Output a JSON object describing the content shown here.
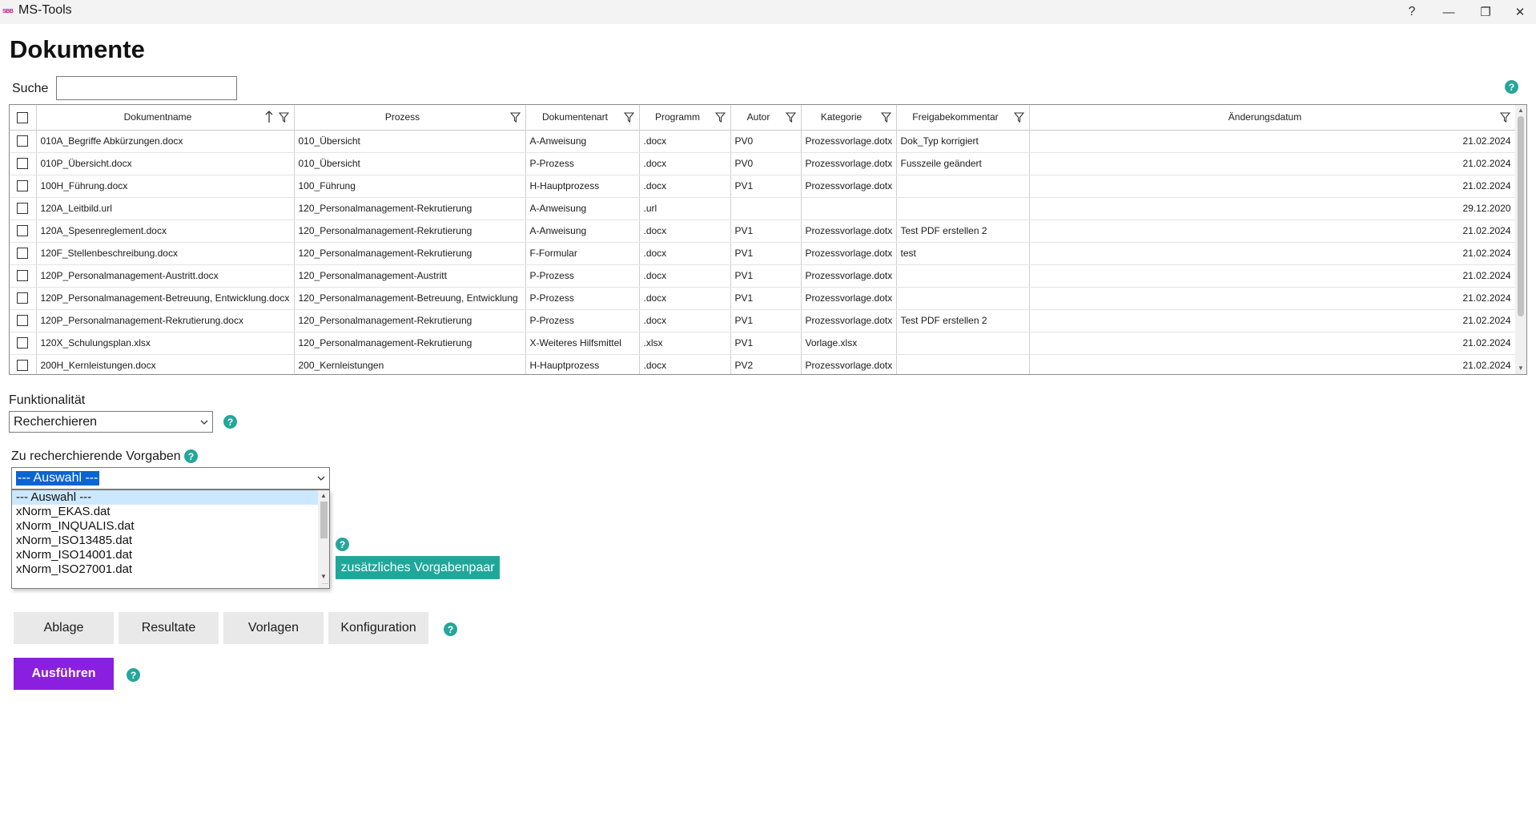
{
  "window": {
    "title": "MS-Tools",
    "logo_text": "SBB",
    "help_glyph": "?",
    "minimize_glyph": "—",
    "maximize_glyph": "❐",
    "close_glyph": "✕"
  },
  "page": {
    "title": "Dokumente"
  },
  "search": {
    "label": "Suche",
    "value": ""
  },
  "help_glyph": "?",
  "table": {
    "columns": [
      "Dokumentname",
      "Prozess",
      "Dokumentenart",
      "Programm",
      "Autor",
      "Kategorie",
      "Freigabekommentar",
      "Änderungsdatum"
    ],
    "sorted_column": "Dokumentname",
    "rows": [
      [
        "010A_Begriffe Abkürzungen.docx",
        "010_Übersicht",
        "A-Anweisung",
        ".docx",
        "PV0",
        "Prozessvorlage.dotx",
        "Dok_Typ korrigiert",
        "21.02.2024"
      ],
      [
        "010P_Übersicht.docx",
        "010_Übersicht",
        "P-Prozess",
        ".docx",
        "PV0",
        "Prozessvorlage.dotx",
        "Fusszeile geändert",
        "21.02.2024"
      ],
      [
        "100H_Führung.docx",
        "100_Führung",
        "H-Hauptprozess",
        ".docx",
        "PV1",
        "Prozessvorlage.dotx",
        "",
        "21.02.2024"
      ],
      [
        "120A_Leitbild.url",
        "120_Personalmanagement-Rekrutierung",
        "A-Anweisung",
        ".url",
        "",
        "",
        "",
        "29.12.2020"
      ],
      [
        "120A_Spesenreglement.docx",
        "120_Personalmanagement-Rekrutierung",
        "A-Anweisung",
        ".docx",
        "PV1",
        "Prozessvorlage.dotx",
        "Test PDF erstellen 2",
        "21.02.2024"
      ],
      [
        "120F_Stellenbeschreibung.docx",
        "120_Personalmanagement-Rekrutierung",
        "F-Formular",
        ".docx",
        "PV1",
        "Prozessvorlage.dotx",
        "test",
        "21.02.2024"
      ],
      [
        "120P_Personalmanagement-Austritt.docx",
        "120_Personalmanagement-Austritt",
        "P-Prozess",
        ".docx",
        "PV1",
        "Prozessvorlage.dotx",
        "",
        "21.02.2024"
      ],
      [
        "120P_Personalmanagement-Betreuung, Entwicklung.docx",
        "120_Personalmanagement-Betreuung, Entwicklung",
        "P-Prozess",
        ".docx",
        "PV1",
        "Prozessvorlage.dotx",
        "",
        "21.02.2024"
      ],
      [
        "120P_Personalmanagement-Rekrutierung.docx",
        "120_Personalmanagement-Rekrutierung",
        "P-Prozess",
        ".docx",
        "PV1",
        "Prozessvorlage.dotx",
        "Test PDF erstellen 2",
        "21.02.2024"
      ],
      [
        "120X_Schulungsplan.xlsx",
        "120_Personalmanagement-Rekrutierung",
        "X-Weiteres Hilfsmittel",
        ".xlsx",
        "PV1",
        "Vorlage.xlsx",
        "",
        "21.02.2024"
      ],
      [
        "200H_Kernleistungen.docx",
        "200_Kernleistungen",
        "H-Hauptprozess",
        ".docx",
        "PV2",
        "Prozessvorlage.dotx",
        "",
        "21.02.2024"
      ]
    ]
  },
  "functionality": {
    "label": "Funktionalität",
    "selected": "Recherchieren"
  },
  "requirements": {
    "label": "Zu recherchierende Vorgaben",
    "selected": "--- Auswahl ---",
    "options": [
      "--- Auswahl ---",
      "xNorm_EKAS.dat",
      "xNorm_INQUALIS.dat",
      "xNorm_ISO13485.dat",
      "xNorm_ISO14001.dat",
      "xNorm_ISO27001.dat"
    ],
    "highlighted_index": 0
  },
  "add_pair_button": "zusätzliches Vorgabenpaar",
  "buttons": {
    "ablage": "Ablage",
    "resultate": "Resultate",
    "vorlagen": "Vorlagen",
    "konfiguration": "Konfiguration"
  },
  "run_button": "Ausführen",
  "colors": {
    "accent_teal": "#1fa89a",
    "run_purple": "#8a1fe0",
    "selection_blue": "#0a64d4"
  },
  "icons": {
    "filter": "funnel-icon",
    "sort": "sort-ascending-icon",
    "help": "help-circle-icon"
  }
}
